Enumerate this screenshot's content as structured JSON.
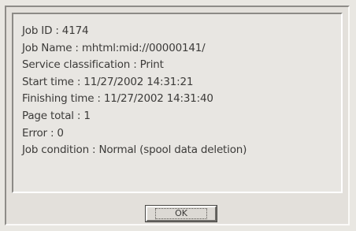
{
  "job_info": {
    "lines": [
      "Job ID : 4174",
      "Job Name : mhtml:mid://00000141/",
      "Service classification : Print",
      "Start time : 11/27/2002 14:31:21",
      "Finishing time : 11/27/2002 14:31:40",
      "Page total : 1",
      "Error : 0",
      "Job condition : Normal (spool data deletion)"
    ]
  },
  "buttons": {
    "ok_label": "OK"
  }
}
